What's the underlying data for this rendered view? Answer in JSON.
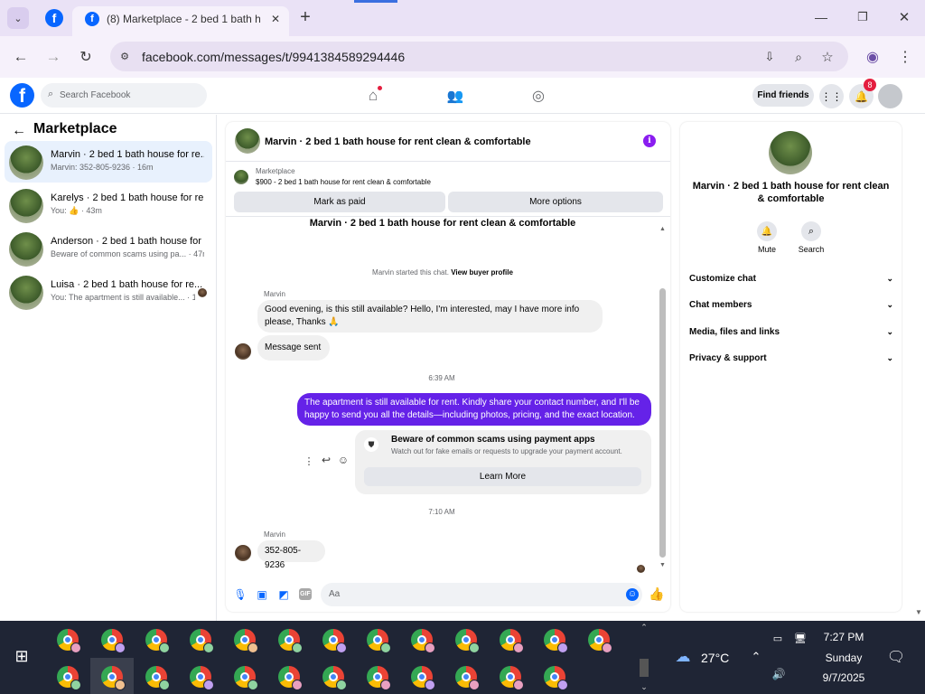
{
  "browser": {
    "tab_title": "(8) Marketplace - 2 bed 1 bath h",
    "url": "facebook.com/messages/t/9941384589294446"
  },
  "fb": {
    "search_placeholder": "Search Facebook",
    "find_friends": "Find friends",
    "notif_count": "8"
  },
  "left": {
    "heading": "Marketplace",
    "conversations": [
      {
        "title": "Marvin · 2 bed 1 bath house for re...",
        "sub": "Marvin: 352-805-9236 · 16m"
      },
      {
        "title": "Karelys · 2 bed 1 bath house for re...",
        "sub": "You: 👍 · 43m"
      },
      {
        "title": "Anderson · 2 bed 1 bath house for ...",
        "sub": "Beware of common scams using pa... · 47m"
      },
      {
        "title": "Luisa · 2 bed 1 bath house for re...",
        "sub": "You: The apartment is still available... · 1d"
      }
    ]
  },
  "chat": {
    "header_title": "Marvin · 2 bed 1 bath house for rent clean & comfortable",
    "marketplace_label": "Marketplace",
    "listing": "$900 - 2 bed 1 bath house for rent clean & comfortable",
    "mark_paid": "Mark as paid",
    "more_options": "More options",
    "listing_title": "Marvin · 2 bed 1 bath house for rent clean & comfortable",
    "started": "Marvin started this chat.",
    "view_profile": "View buyer profile",
    "sender1": "Marvin",
    "msg1": "Good evening, is this still available? Hello, I'm interested, may I have more info please, Thanks 🙏",
    "msg2": "Message sent",
    "time1": "6:39 AM",
    "msg3": "The apartment is still available for rent. Kindly share your contact number, and I'll be happy to send you all the details—including photos, pricing, and the exact location.",
    "scam_title": "Beware of common scams using payment apps",
    "scam_text": "Watch out for fake emails or requests to upgrade your payment account.",
    "learn_more": "Learn More",
    "time2": "7:10 AM",
    "sender2": "Marvin",
    "msg4": "352-805-9236",
    "input_placeholder": "Aa"
  },
  "info": {
    "name": "Marvin · 2 bed 1 bath house for rent clean & comfortable",
    "mute": "Mute",
    "search": "Search",
    "sections": [
      "Customize chat",
      "Chat members",
      "Media, files and links",
      "Privacy & support"
    ]
  },
  "taskbar": {
    "weather": "27°C",
    "time": "7:27 PM",
    "day": "Sunday",
    "date": "9/7/2025"
  },
  "colors": {
    "accent": "#6522e8",
    "fb_blue": "#0866ff"
  }
}
